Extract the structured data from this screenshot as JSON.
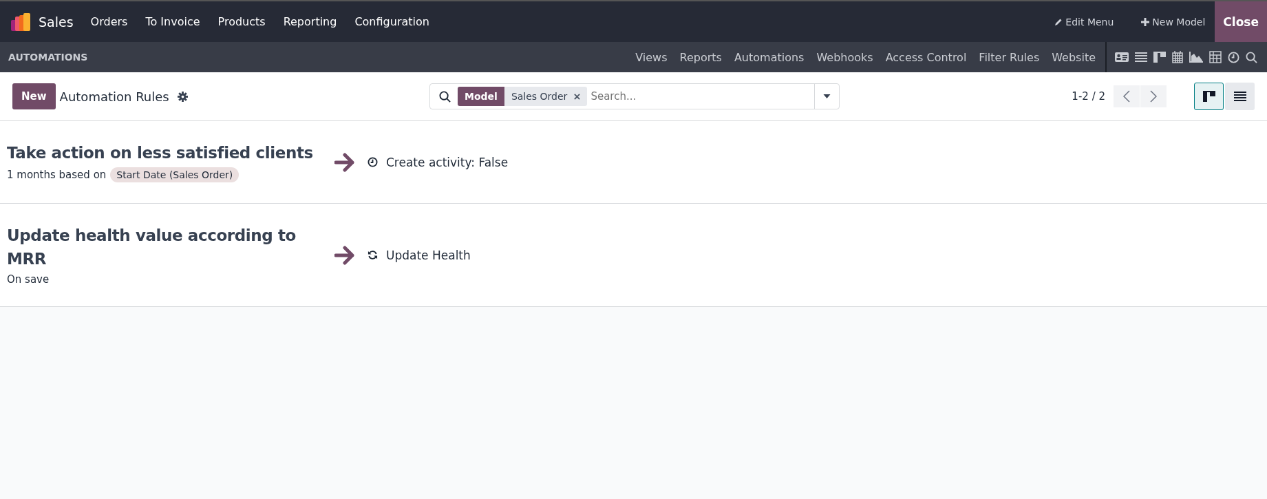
{
  "top_bar": {
    "app_name": "Sales",
    "menu": [
      "Orders",
      "To Invoice",
      "Products",
      "Reporting",
      "Configuration"
    ],
    "edit_menu": "Edit Menu",
    "new_model": "New Model",
    "close": "Close"
  },
  "studio_bar": {
    "title": "AUTOMATIONS",
    "tabs": [
      "Views",
      "Reports",
      "Automations",
      "Webhooks",
      "Access Control",
      "Filter Rules",
      "Website"
    ]
  },
  "control_panel": {
    "new_button": "New",
    "title": "Automation Rules",
    "search": {
      "facet_label": "Model",
      "facet_value": "Sales Order",
      "placeholder": "Search..."
    },
    "pager": "1-2 / 2",
    "views": [
      {
        "kind": "kanban",
        "selected": true
      },
      {
        "kind": "list",
        "selected": false
      }
    ]
  },
  "rules": [
    {
      "name": "Take action on less satisfied clients",
      "trigger": "1 months based on",
      "trigger_field": "Start Date (Sales Order)",
      "kind": "activity",
      "action": "Create activity: False"
    },
    {
      "name": "Update health value according to MRR",
      "trigger": "On save",
      "kind": "update",
      "action": "Update Health"
    }
  ]
}
